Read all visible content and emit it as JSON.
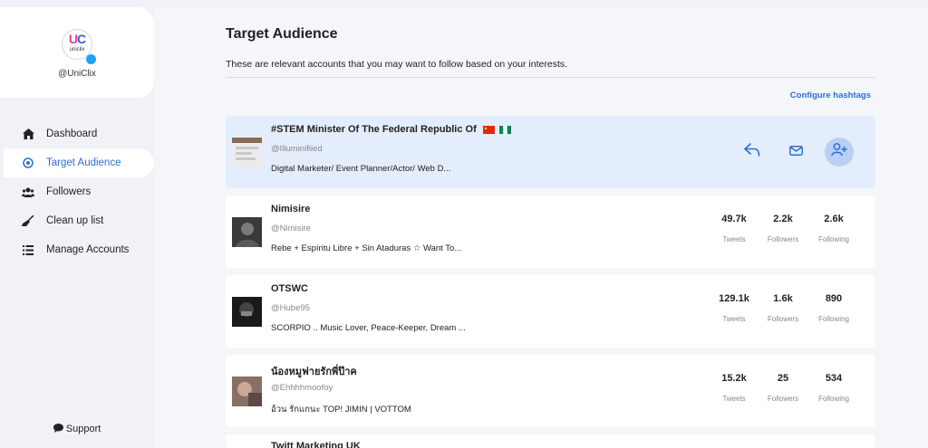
{
  "sidebar": {
    "handle": "@UniClix",
    "items": [
      {
        "label": "Dashboard",
        "icon": "home-icon",
        "active": false
      },
      {
        "label": "Target Audience",
        "icon": "target-icon",
        "active": true
      },
      {
        "label": "Followers",
        "icon": "users-icon",
        "active": false
      },
      {
        "label": "Clean up list",
        "icon": "broom-icon",
        "active": false
      },
      {
        "label": "Manage Accounts",
        "icon": "list-icon",
        "active": false
      }
    ],
    "support": "Support"
  },
  "main": {
    "title": "Target Audience",
    "subtitle": "These are relevant accounts that you may want to follow based on your interests.",
    "configure_label": "Configure hashtags",
    "accounts": [
      {
        "name": "#STEM Minister Of The Federal Republic Of",
        "username": "@Illuminifiied",
        "bio": "Digital Marketer/ Event Planner/Actor/ Web D..."
      },
      {
        "name": "Nimisire",
        "username": "@Nimisire",
        "bio": "Rebe + Espíritu Libre + Sin Ataduras ☆ Want To...",
        "tweets": "49.7k",
        "followers": "2.2k",
        "following": "2.6k"
      },
      {
        "name": "OTSWC",
        "username": "@Hube95",
        "bio": "SCORPIO .. Music Lover, Peace-Keeper, Dream ...",
        "tweets": "129.1k",
        "followers": "1.6k",
        "following": "890"
      },
      {
        "name": "น้องหมูฟายรักพี่ป๊าค",
        "username": "@Ehhhhmoofoy",
        "bio": "อ้วน รักแกนะ TOP! JIMIN | VOTTOM",
        "tweets": "15.2k",
        "followers": "25",
        "following": "534"
      },
      {
        "name": "Twitt Marketing UK"
      }
    ],
    "stat_labels": {
      "tweets": "Tweets",
      "followers": "Followers",
      "following": "Following"
    }
  },
  "colors": {
    "accent": "#2d6fd6",
    "highlight_card": "#e4edfb",
    "background": "#f0f2f7"
  }
}
